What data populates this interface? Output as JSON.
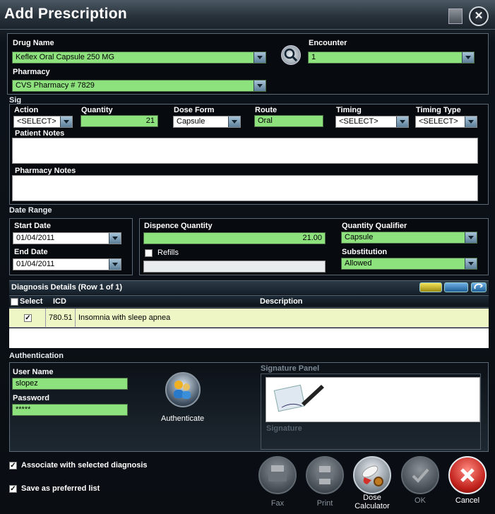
{
  "window": {
    "title": "Add Prescription"
  },
  "drug": {
    "drug_name_label": "Drug Name",
    "drug_name_value": "Keflex Oral Capsule 250 MG",
    "pharmacy_label": "Pharmacy",
    "pharmacy_value": "CVS Pharmacy # 7829",
    "encounter_label": "Encounter",
    "encounter_value": "1"
  },
  "sig": {
    "section_label": "Sig",
    "action_label": "Action",
    "action_value": "<SELECT>",
    "quantity_label": "Quantity",
    "quantity_value": "21",
    "dose_form_label": "Dose Form",
    "dose_form_value": "Capsule",
    "route_label": "Route",
    "route_value": "Oral",
    "timing_label": "Timing",
    "timing_value": "<SELECT>",
    "timing_type_label": "Timing Type",
    "timing_type_value": "<SELECT>",
    "patient_notes_label": "Patient Notes",
    "pharmacy_notes_label": "Pharmacy Notes"
  },
  "date_range": {
    "section_label": "Date Range",
    "start_label": "Start Date",
    "start_value": "01/04/2011",
    "end_label": "End Date",
    "end_value": "01/04/2011"
  },
  "dispense": {
    "quantity_label": "Dispence Quantity",
    "quantity_value": "21.00",
    "refills_label": "Refills",
    "qualifier_label": "Quantity Qualifier",
    "qualifier_value": "Capsule",
    "substitution_label": "Substitution",
    "substitution_value": "Allowed"
  },
  "diagnosis": {
    "header": "Diagnosis Details (Row 1 of 1)",
    "columns": {
      "select": "Select",
      "icd": "ICD",
      "description": "Description"
    },
    "rows": [
      {
        "icd": "780.51",
        "description": "Insomnia with sleep apnea"
      }
    ]
  },
  "auth": {
    "section_label": "Authentication",
    "user_label": "User Name",
    "user_value": "slopez",
    "password_label": "Password",
    "password_value": "*****",
    "authenticate_label": "Authenticate",
    "signature_panel_label": "Signature Panel",
    "signature_label": "Signature"
  },
  "options": {
    "associate_label": "Associate with selected diagnosis",
    "preferred_label": "Save as preferred list"
  },
  "actions": {
    "fax": "Fax",
    "print": "Print",
    "dose_calc": "Dose Calculator",
    "ok": "OK",
    "cancel": "Cancel"
  }
}
